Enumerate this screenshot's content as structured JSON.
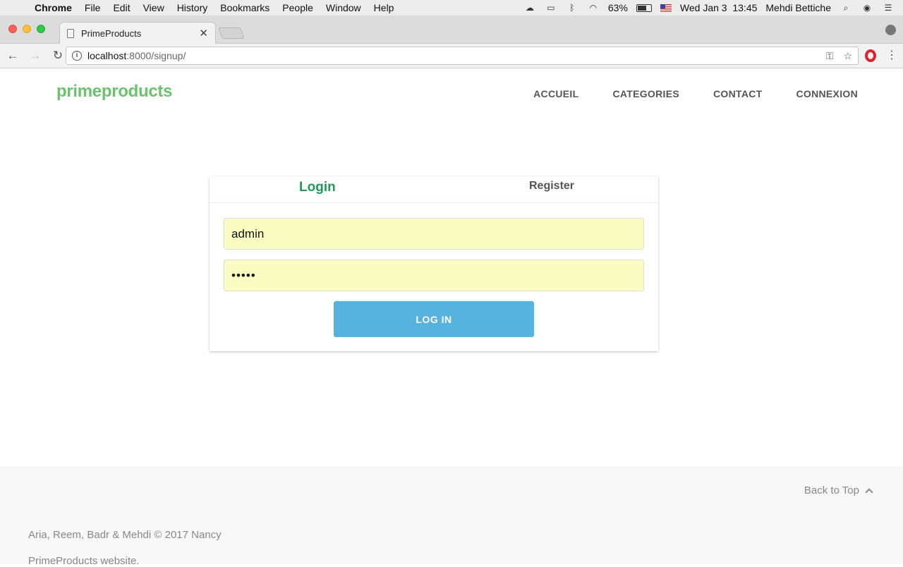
{
  "menubar": {
    "app": "Chrome",
    "items": [
      "File",
      "Edit",
      "View",
      "History",
      "Bookmarks",
      "People",
      "Window",
      "Help"
    ],
    "battery": "63%",
    "datetime": "Wed Jan 3  13:45",
    "user": "Mehdi Bettiche"
  },
  "browser": {
    "tab_title": "PrimeProducts",
    "url_host": "localhost",
    "url_rest": ":8000/signup/"
  },
  "site": {
    "brand": "primeproducts",
    "nav": [
      "ACCUEIL",
      "CATEGORIES",
      "CONTACT",
      "CONNEXION"
    ]
  },
  "form": {
    "tab_login": "Login",
    "tab_register": "Register",
    "username_value": "admin",
    "password_value": "•••••",
    "submit_label": "LOG IN"
  },
  "footer": {
    "back_to_top": "Back to Top",
    "copyright": "Aria, Reem, Badr & Mehdi © 2017 Nancy",
    "site_line": "PrimeProducts website."
  },
  "colors": {
    "brand": "#6bc36b",
    "login_tab": "#1e9b58",
    "button": "#55b3dd",
    "autofill": "#fafcc2"
  }
}
